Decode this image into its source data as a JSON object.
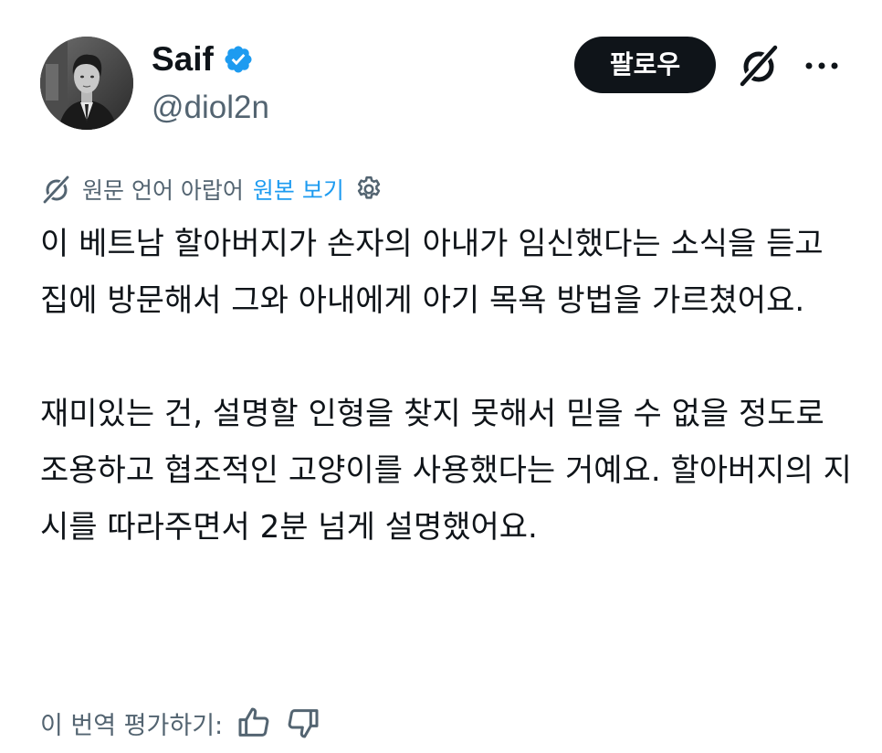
{
  "author": {
    "display_name": "Saif",
    "handle": "@diol2n",
    "verified": true,
    "verified_color": "#1d9bf0"
  },
  "actions": {
    "follow_label": "팔로우",
    "grok_icon": "grok-icon",
    "more_icon": "more-icon"
  },
  "translation": {
    "notice": "원문 언어 아랍어",
    "show_original": "원본 보기",
    "settings_icon": "gear-icon",
    "link_color": "#1d9bf0"
  },
  "tweet": {
    "paragraph_1": "이 베트남 할아버지가 손자의 아내가 임신했다는 소식을 듣고 집에 방문해서 그와 아내에게 아기 목욕 방법을 가르쳤어요.",
    "paragraph_2": "재미있는 건, 설명할 인형을 찾지 못해서 믿을 수 없을 정도로 조용하고 협조적인 고양이를 사용했다는 거예요. 할아버지의 지시를 따라주면서 2분 넘게 설명했어요."
  },
  "rating": {
    "label": "이 번역 평가하기:",
    "thumbs_up_icon": "thumbs-up-icon",
    "thumbs_down_icon": "thumbs-down-icon"
  }
}
